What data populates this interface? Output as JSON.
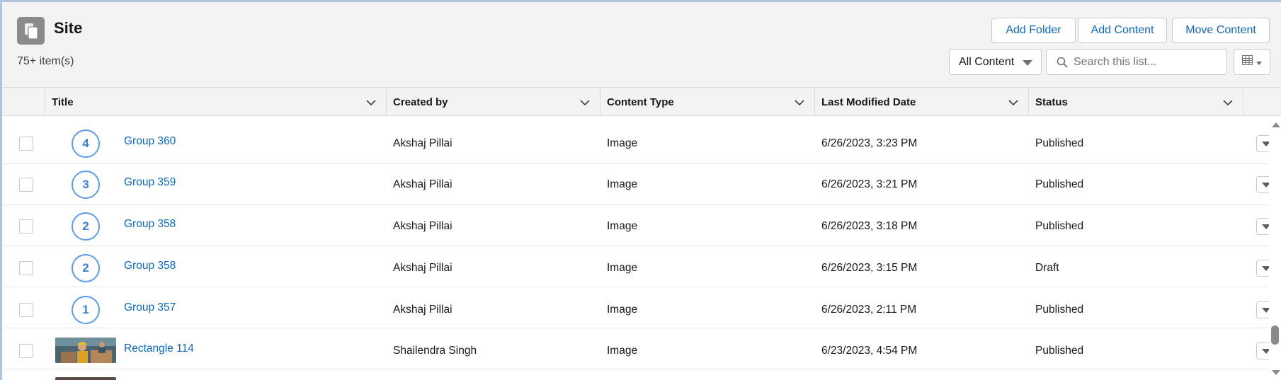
{
  "header": {
    "title": "Site",
    "item_count": "75+ item(s)",
    "buttons": {
      "add_folder": "Add Folder",
      "add_content": "Add Content",
      "move_content": "Move Content"
    },
    "filter_select": {
      "value": "All Content"
    },
    "search": {
      "placeholder": "Search this list..."
    }
  },
  "columns": {
    "title": "Title",
    "created_by": "Created by",
    "content_type": "Content Type",
    "last_modified": "Last Modified Date",
    "status": "Status"
  },
  "rows": [
    {
      "badge": "4",
      "title": "Group 360",
      "created_by": "Akshaj Pillai",
      "content_type": "Image",
      "last_modified": "6/26/2023, 3:23 PM",
      "status": "Published"
    },
    {
      "badge": "3",
      "title": "Group 359",
      "created_by": "Akshaj Pillai",
      "content_type": "Image",
      "last_modified": "6/26/2023, 3:21 PM",
      "status": "Published"
    },
    {
      "badge": "2",
      "title": "Group 358",
      "created_by": "Akshaj Pillai",
      "content_type": "Image",
      "last_modified": "6/26/2023, 3:18 PM",
      "status": "Published"
    },
    {
      "badge": "2",
      "title": "Group 358",
      "created_by": "Akshaj Pillai",
      "content_type": "Image",
      "last_modified": "6/26/2023, 3:15 PM",
      "status": "Draft"
    },
    {
      "badge": "1",
      "title": "Group 357",
      "created_by": "Akshaj Pillai",
      "content_type": "Image",
      "last_modified": "6/26/2023, 2:11 PM",
      "status": "Published"
    },
    {
      "badge": "",
      "title": "Rectangle 114",
      "created_by": "Shailendra Singh",
      "content_type": "Image",
      "last_modified": "6/23/2023, 4:54 PM",
      "status": "Published"
    }
  ],
  "colors": {
    "link": "#0b69c6",
    "badge_border": "#5d9cec",
    "header_bg": "#f3f3f3",
    "frame_border": "#b0c4de"
  }
}
